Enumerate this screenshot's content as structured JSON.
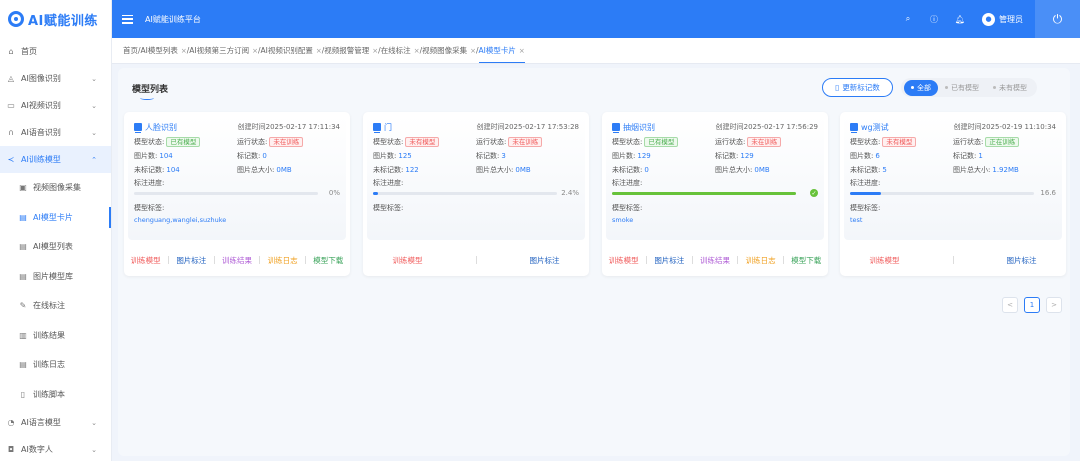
{
  "app": {
    "logo_text": "AI赋能训练"
  },
  "sidebar": {
    "items": [
      {
        "label": "首页",
        "icon": "home-icon",
        "glyph": "⌂"
      },
      {
        "label": "AI图像识别",
        "icon": "image-recognition-icon",
        "glyph": "◬"
      },
      {
        "label": "AI视频识别",
        "icon": "video-icon",
        "glyph": "▭"
      },
      {
        "label": "AI语音识别",
        "icon": "headphones-icon",
        "glyph": "∩"
      },
      {
        "label": "AI训练模型",
        "icon": "share-icon",
        "glyph": "≺"
      }
    ],
    "sub_items": [
      {
        "label": "视频图像采集",
        "icon": "image-icon",
        "glyph": "▣"
      },
      {
        "label": "AI模型卡片",
        "icon": "document-icon",
        "glyph": "▤"
      },
      {
        "label": "AI模型列表",
        "icon": "list-doc-icon",
        "glyph": "▤"
      },
      {
        "label": "图片模型库",
        "icon": "library-icon",
        "glyph": "▤"
      },
      {
        "label": "在线标注",
        "icon": "edit-icon",
        "glyph": "✎"
      },
      {
        "label": "训练结果",
        "icon": "result-icon",
        "glyph": "▥"
      },
      {
        "label": "训练日志",
        "icon": "log-icon",
        "glyph": "▤"
      },
      {
        "label": "训练脚本",
        "icon": "script-icon",
        "glyph": "▯"
      }
    ],
    "bottom_items": [
      {
        "label": "AI语言模型",
        "icon": "chat-icon",
        "glyph": "◔"
      },
      {
        "label": "AI数字人",
        "icon": "digital-human-icon",
        "glyph": "◘"
      }
    ]
  },
  "header": {
    "title": "AI赋能训练平台",
    "username": "管理员"
  },
  "breadcrumbs": [
    {
      "label": "首页",
      "closable": false
    },
    {
      "label": "AI模型列表",
      "closable": true
    },
    {
      "label": "AI视频第三方订阅",
      "closable": true
    },
    {
      "label": "AI视频识别配置",
      "closable": true
    },
    {
      "label": "视频报警管理",
      "closable": true
    },
    {
      "label": "在线标注",
      "closable": true
    },
    {
      "label": "视频图像采集",
      "closable": true
    },
    {
      "label": "AI模型卡片",
      "closable": true
    }
  ],
  "main": {
    "title": "模型列表",
    "update_button": "更新标记数",
    "filters": [
      "全部",
      "已有模型",
      "未有模型"
    ]
  },
  "labels": {
    "model_status": "模型状态:",
    "run_status": "运行状态:",
    "image_count": "图片数:",
    "marked_count": "标记数:",
    "unmarked_count": "未标记数:",
    "image_total_size": "图片总大小:",
    "label_progress": "标注进度:",
    "model_tags": "模型标签:",
    "created_prefix": "创建时间"
  },
  "cards": [
    {
      "name": "人脸识别",
      "created": "2025-02-17 17:11:34",
      "model_status": "已有模型",
      "model_status_color": "green",
      "run_status": "未在训练",
      "run_status_color": "red",
      "image_count": "104",
      "marked_count": "0",
      "unmarked_count": "104",
      "image_total_size": "0MB",
      "progress": 0,
      "progress_text": "0%",
      "progress_done": false,
      "tags": "chenguang,wanglei,suzhuke",
      "actions": [
        "训练模型",
        "图片标注",
        "训练结果",
        "训练日志",
        "模型下载"
      ]
    },
    {
      "name": "门",
      "created": "2025-02-17 17:53:28",
      "model_status": "未有模型",
      "model_status_color": "red",
      "run_status": "未在训练",
      "run_status_color": "red",
      "image_count": "125",
      "marked_count": "3",
      "unmarked_count": "122",
      "image_total_size": "0MB",
      "progress": 2.4,
      "progress_text": "2.4%",
      "progress_done": false,
      "tags": "",
      "actions": [
        "训练模型",
        "图片标注"
      ]
    },
    {
      "name": "抽烟识别",
      "created": "2025-02-17 17:56:29",
      "model_status": "已有模型",
      "model_status_color": "green",
      "run_status": "未在训练",
      "run_status_color": "red",
      "image_count": "129",
      "marked_count": "129",
      "unmarked_count": "0",
      "image_total_size": "0MB",
      "progress": 100,
      "progress_text": "",
      "progress_done": true,
      "tags": "smoke",
      "actions": [
        "训练模型",
        "图片标注",
        "训练结果",
        "训练日志",
        "模型下载"
      ]
    },
    {
      "name": "wg测试",
      "created": "2025-02-19 11:10:34",
      "model_status": "未有模型",
      "model_status_color": "red",
      "run_status": "正在训练",
      "run_status_color": "green",
      "image_count": "6",
      "marked_count": "1",
      "unmarked_count": "5",
      "image_total_size": "1.92MB",
      "progress": 16.6,
      "progress_text": "16.6",
      "progress_done": false,
      "tags": "test",
      "actions": [
        "训练模型",
        "图片标注"
      ]
    }
  ],
  "pagination": {
    "prev": "<",
    "current": "1",
    "next": ">"
  },
  "colors": {
    "accent": "#2c7cf6",
    "danger": "#f05a5a",
    "success": "#67c23a"
  }
}
